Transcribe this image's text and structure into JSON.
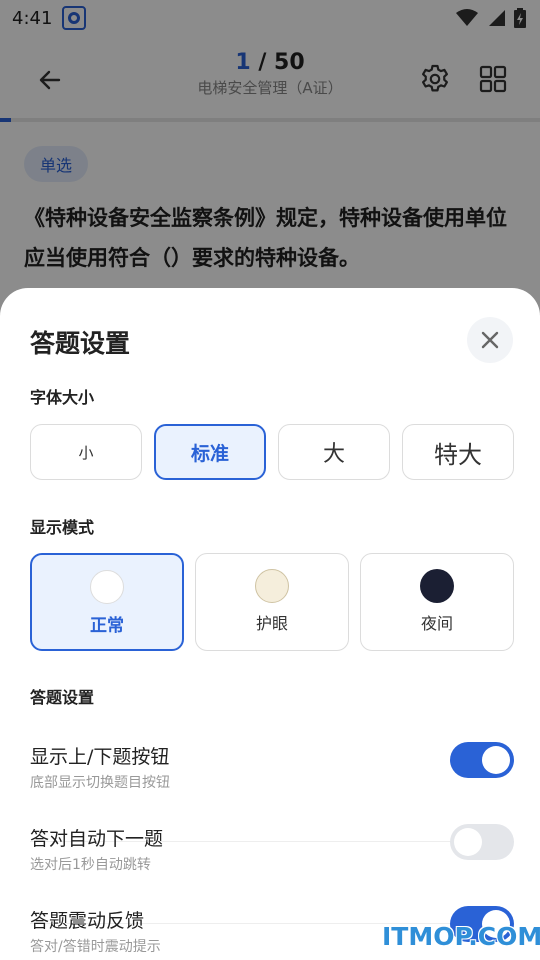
{
  "status_bar": {
    "time": "4:41"
  },
  "header": {
    "progress_current": "1",
    "progress_separator": " / ",
    "progress_total": "50",
    "subject": "电梯安全管理（A证）"
  },
  "progress": {
    "answered": 1,
    "total": 50
  },
  "question": {
    "type": "单选",
    "text": "《特种设备安全监察条例》规定，特种设备使用单位应当使用符合（）要求的特种设备。"
  },
  "settings_sheet": {
    "title": "答题设置",
    "font_size": {
      "label": "字体大小",
      "options": [
        "小",
        "标准",
        "大",
        "特大"
      ],
      "selected": "标准"
    },
    "display_mode": {
      "label": "显示模式",
      "options": [
        {
          "label": "正常",
          "swatch": "#ffffff"
        },
        {
          "label": "护眼",
          "swatch": "#f5eedc"
        },
        {
          "label": "夜间",
          "swatch": "#1b1f33"
        }
      ],
      "selected": "正常"
    },
    "answer_settings": {
      "label": "答题设置",
      "items": [
        {
          "title": "显示上/下题按钮",
          "desc": "底部显示切换题目按钮",
          "enabled": true
        },
        {
          "title": "答对自动下一题",
          "desc": "选对后1秒自动跳转",
          "enabled": false
        },
        {
          "title": "答题震动反馈",
          "desc": "答对/答错时震动提示",
          "enabled": true
        }
      ]
    }
  },
  "watermark": "ITMOP.COM",
  "colors": {
    "accent": "#2a62d6",
    "toggle_off": "#e4e6ea"
  }
}
